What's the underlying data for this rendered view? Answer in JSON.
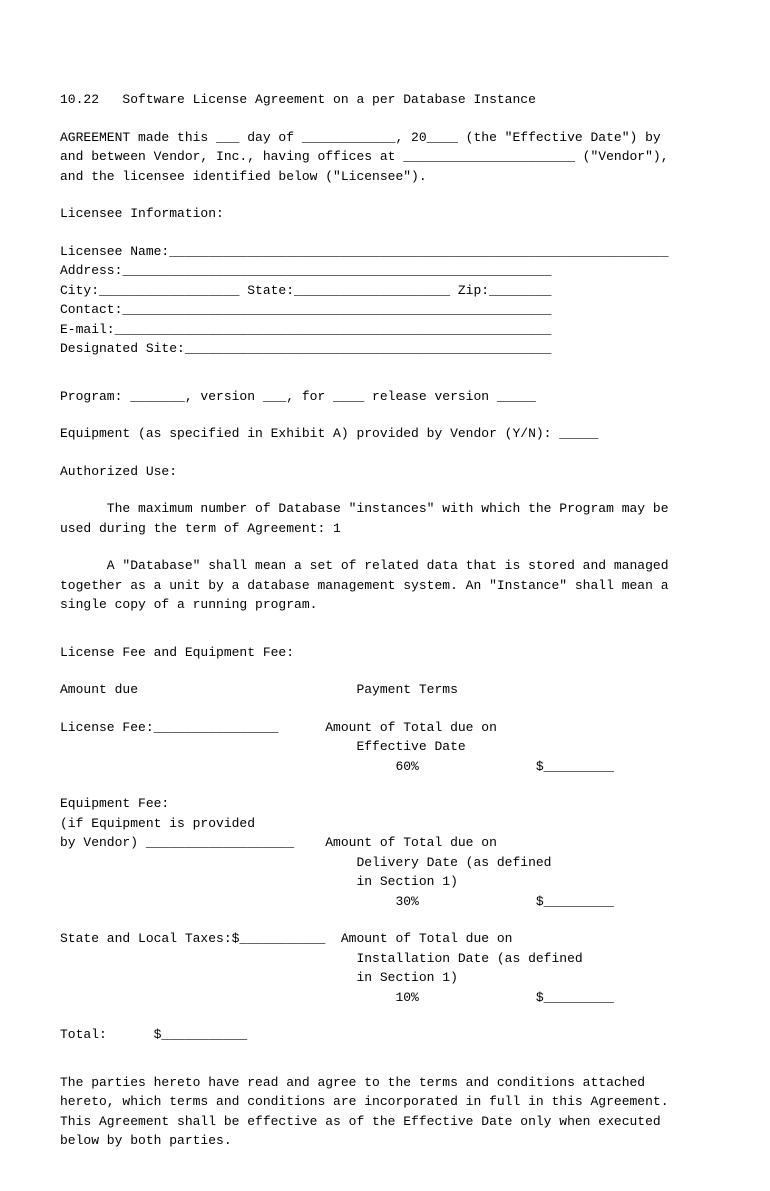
{
  "title": "10.22   Software License Agreement on a per Database Instance",
  "agreement_intro": "AGREEMENT made this ___ day of ____________, 20____ (the \"Effective Date\") by\nand between Vendor, Inc., having offices at ______________________ (\"Vendor\"),\nand the licensee identified below (\"Licensee\").",
  "licensee_info_header": "Licensee Information:",
  "licensee_name": "Licensee Name:________________________________________________________________",
  "address": "Address:_______________________________________________________",
  "city_state_zip": "City:__________________ State:____________________ Zip:________",
  "contact": "Contact:_______________________________________________________",
  "email": "E-mail:________________________________________________________",
  "designated_site": "Designated Site:_______________________________________________",
  "program_line": "Program: _______, version ___, for ____ release version _____",
  "equipment_line": "Equipment (as specified in Exhibit A) provided by Vendor (Y/N): _____",
  "authorized_use_header": "Authorized Use:",
  "authorized_use_1": "      The maximum number of Database \"instances\" with which the Program may be\nused during the term of Agreement: 1",
  "authorized_use_2": "      A \"Database\" shall mean a set of related data that is stored and managed\ntogether as a unit by a database management system. An \"Instance\" shall mean a\nsingle copy of a running program.",
  "fee_header": "License Fee and Equipment Fee:",
  "amount_due_header": "Amount due                            Payment Terms",
  "license_fee_line": "License Fee:________________      Amount of Total due on\n                                      Effective Date\n                                           60%               $_________",
  "equipment_fee_block": "Equipment Fee:\n(if Equipment is provided\nby Vendor) ___________________    Amount of Total due on\n                                      Delivery Date (as defined\n                                      in Section 1)\n                                           30%               $_________",
  "taxes_block": "State and Local Taxes:$___________  Amount of Total due on\n                                      Installation Date (as defined\n                                      in Section 1)\n                                           10%               $_________",
  "total_line": "Total:      $___________",
  "closing_para": "The parties hereto have read and agree to the terms and conditions attached\nhereto, which terms and conditions are incorporated in full in this Agreement.\nThis Agreement shall be effective as of the Effective Date only when executed\nbelow by both parties."
}
